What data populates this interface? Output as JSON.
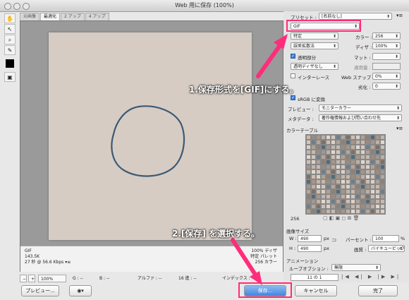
{
  "window": {
    "title": "Web 用に保存 (100%)"
  },
  "tabs": [
    "元画像",
    "最適化",
    "2 アップ",
    "4 アップ"
  ],
  "info_left": [
    "GIF",
    "143.5K",
    "27 秒 @ 56.6 Kbps"
  ],
  "info_left_menu": "▾≡",
  "info_right": [
    "100% ディザ",
    "特定 パレット",
    "256 カラー"
  ],
  "status": {
    "zoom": "100%",
    "g": "G : --",
    "b": "B : --",
    "alpha": "アルファ : --",
    "hex": "16 進 : --",
    "index": "インデックス : --"
  },
  "panel": {
    "preset_label": "プリセット :",
    "preset_value": "[名前なし]",
    "format": "GIF",
    "palette": "特定",
    "colors_label": "カラー :",
    "colors_value": "256",
    "dither_algo": "誤差拡散法",
    "dither_label": "ディザ :",
    "dither_value": "100%",
    "transparency_label": "透明部分",
    "matte_label": "マット :",
    "trans_dither": "透明ディザなし",
    "amount_label": "適用量 :",
    "interlace_label": "インターレース",
    "websnap_label": "Web スナップ :",
    "websnap_value": "0%",
    "lossy_label": "劣化 :",
    "lossy_value": "0",
    "srgb_label": "sRGB に変換",
    "preview_label": "プレビュー :",
    "preview_value": "モニターカラー",
    "metadata_label": "メタデータ :",
    "metadata_value": "著作権情報および問い合わせ先",
    "color_table_label": "カラーテーブル",
    "color_count": "256",
    "image_size_label": "画像サイズ",
    "w_label": "W :",
    "w_value": "490",
    "h_label": "H :",
    "h_value": "490",
    "px": "px",
    "percent_label": "パーセント :",
    "percent_value": "100",
    "percent_sign": "%",
    "quality_label": "画質 :",
    "quality_value": "バイキュービック…",
    "animation_label": "アニメーション",
    "loop_label": "ループオプション :",
    "loop_value": "無限",
    "frame_counter": "11 の 1"
  },
  "buttons": {
    "preview": "プレビュー...",
    "save": "保存...",
    "cancel": "キャンセル",
    "done": "完了"
  },
  "annotations": {
    "step1": "1.保存形式を[GIF]にする。",
    "step2": "2.[保存] を選択する。"
  },
  "colors": {
    "accent": "#ff2d7a",
    "ink": "#3d5a73"
  }
}
